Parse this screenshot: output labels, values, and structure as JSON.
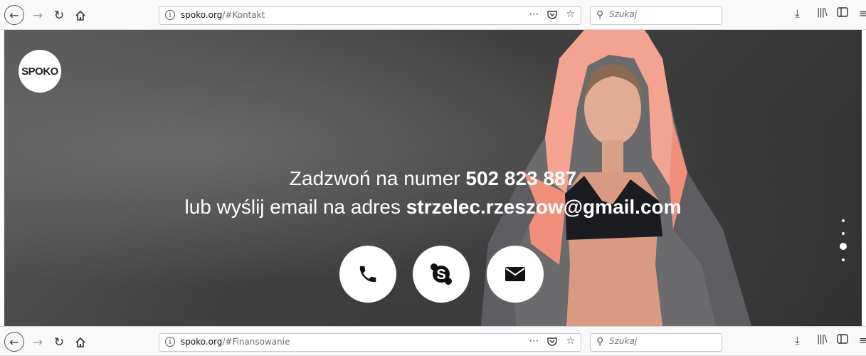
{
  "browser_top": {
    "url_domain": "spoko.org",
    "url_path": "/#Kontakt",
    "search_placeholder": "Szukaj"
  },
  "browser_bottom": {
    "url_domain": "spoko.org",
    "url_path": "/#Finansowanie",
    "search_placeholder": "Szukaj"
  },
  "page": {
    "logo": "SPOKO",
    "line1_text": "Zadzwoń na numer ",
    "phone": "502 823 887",
    "line2_text": "lub wyślij email na adres ",
    "email": "strzelec.rzeszow@gmail.com",
    "contact_buttons": [
      "phone-icon",
      "skype-icon",
      "envelope-icon"
    ],
    "section_dots_count": 4,
    "active_section_index": 2
  },
  "colors": {
    "hero_bg": "#474747",
    "jacket": "#f3a38f",
    "accent_white": "#ffffff"
  }
}
